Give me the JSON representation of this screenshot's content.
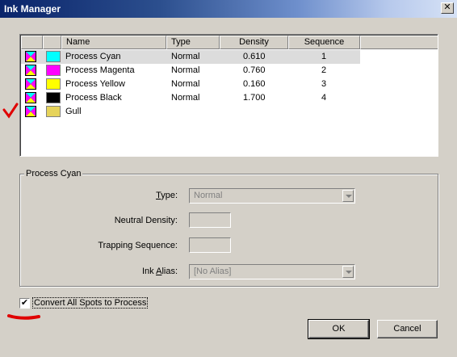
{
  "window": {
    "title": "Ink Manager",
    "close_label": "✕"
  },
  "ink_list": {
    "columns": [
      "Name",
      "Type",
      "Density",
      "Sequence"
    ],
    "rows": [
      {
        "name": "Process Cyan",
        "type": "Normal",
        "density": "0.610",
        "sequence": "1",
        "color": "#00ffff",
        "selected": true
      },
      {
        "name": "Process Magenta",
        "type": "Normal",
        "density": "0.760",
        "sequence": "2",
        "color": "#ff00ff"
      },
      {
        "name": "Process Yellow",
        "type": "Normal",
        "density": "0.160",
        "sequence": "3",
        "color": "#ffff00"
      },
      {
        "name": "Process Black",
        "type": "Normal",
        "density": "1.700",
        "sequence": "4",
        "color": "#000000"
      },
      {
        "name": "Gull",
        "type": "",
        "density": "",
        "sequence": "",
        "color": "#e6d35a"
      }
    ]
  },
  "group": {
    "label": "Process Cyan",
    "type_label": "Type:",
    "type_value": "Normal",
    "neutral_density_label": "Neutral Density:",
    "trapping_sequence_label": "Trapping Sequence:",
    "ink_alias_label": "Ink Alias:",
    "ink_alias_value": "[No Alias]"
  },
  "convert_spots": {
    "label": "Convert All Spots to Process",
    "checked_glyph": "✔"
  },
  "buttons": {
    "ok": "OK",
    "cancel": "Cancel"
  }
}
